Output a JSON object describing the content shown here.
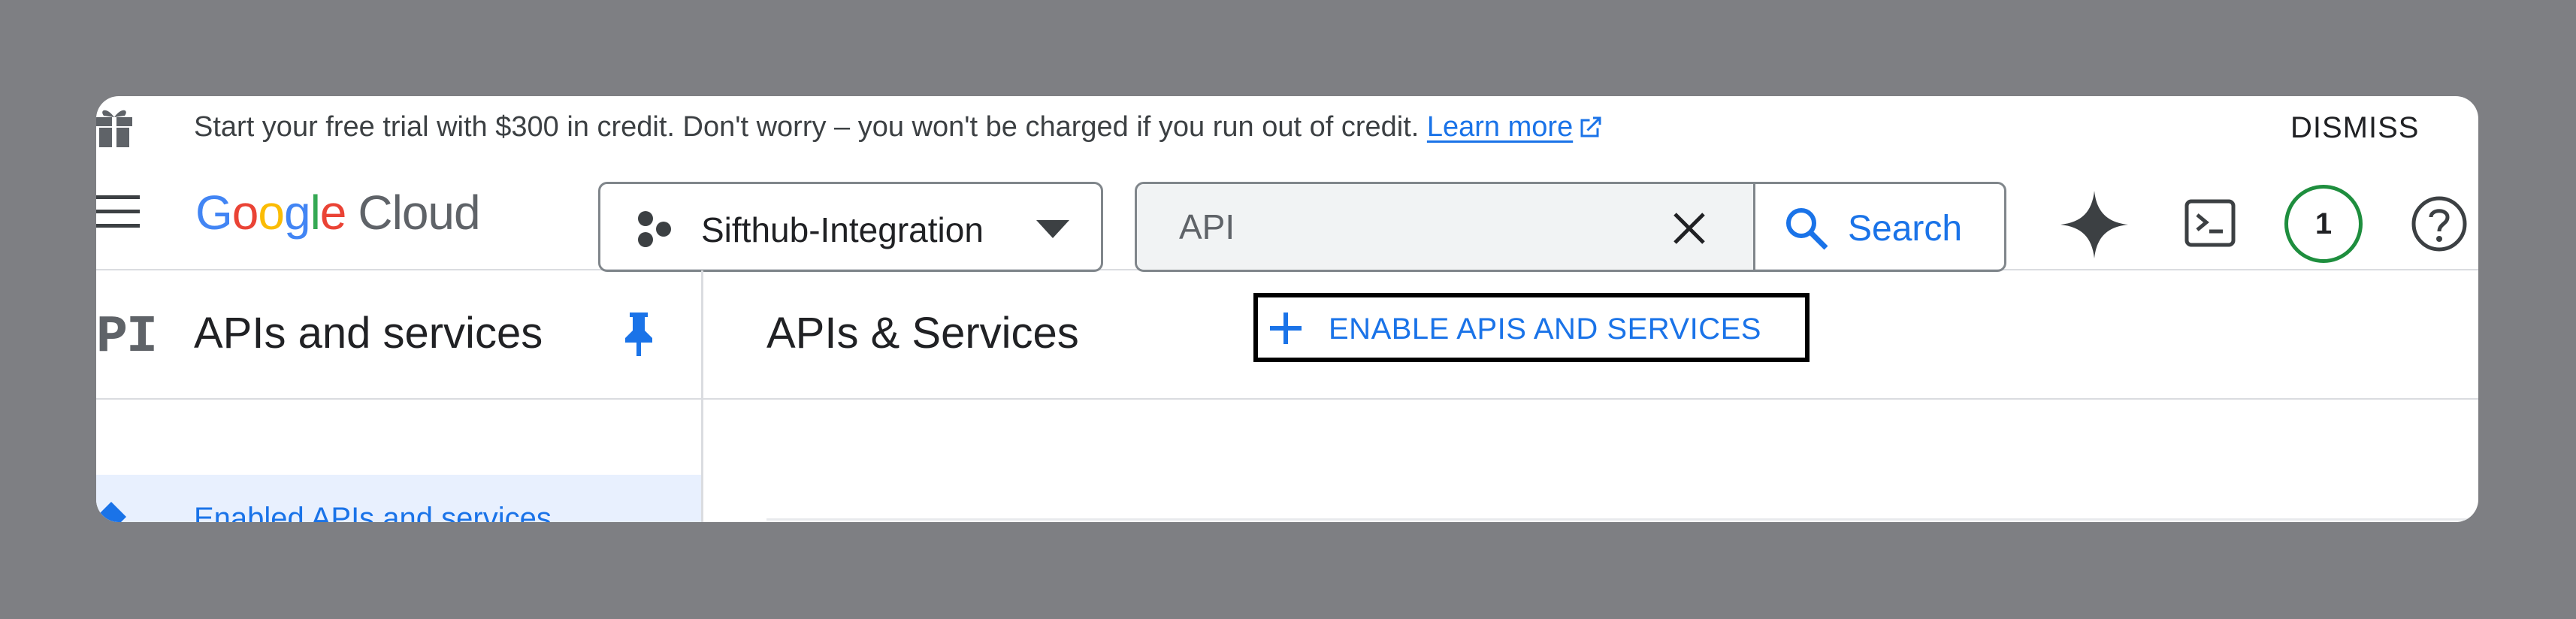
{
  "banner": {
    "message": "Start your free trial with $300 in credit. Don't worry – you won't be charged if you run out of credit.",
    "learn_more": "Learn more",
    "dismiss": "DISMISS"
  },
  "header": {
    "logo_letters": [
      "G",
      "o",
      "o",
      "g",
      "l",
      "e"
    ],
    "logo_product": "Cloud",
    "project_name": "Sifthub-Integration",
    "search_value": "API",
    "search_button": "Search",
    "notification_count": "1"
  },
  "subheader": {
    "product_glyph": "PI",
    "sidebar_title": "APIs and services",
    "page_title": "APIs & Services",
    "enable_button": "ENABLE APIS AND SERVICES"
  },
  "sidebar": {
    "items": [
      {
        "label": "Enabled APIs and services",
        "selected": true
      }
    ]
  },
  "colors": {
    "accent": "#1a73e8",
    "background_outer": "#7e7f83",
    "badge_ring": "#1e8e3e",
    "selected_bg": "#e8f0fe"
  },
  "icons": [
    "gift-icon",
    "external-link-icon",
    "menu-icon",
    "project-icon",
    "chevron-down-icon",
    "close-icon",
    "search-icon",
    "gemini-icon",
    "terminal-icon",
    "help-icon",
    "pin-icon",
    "plus-icon",
    "api-icon"
  ]
}
